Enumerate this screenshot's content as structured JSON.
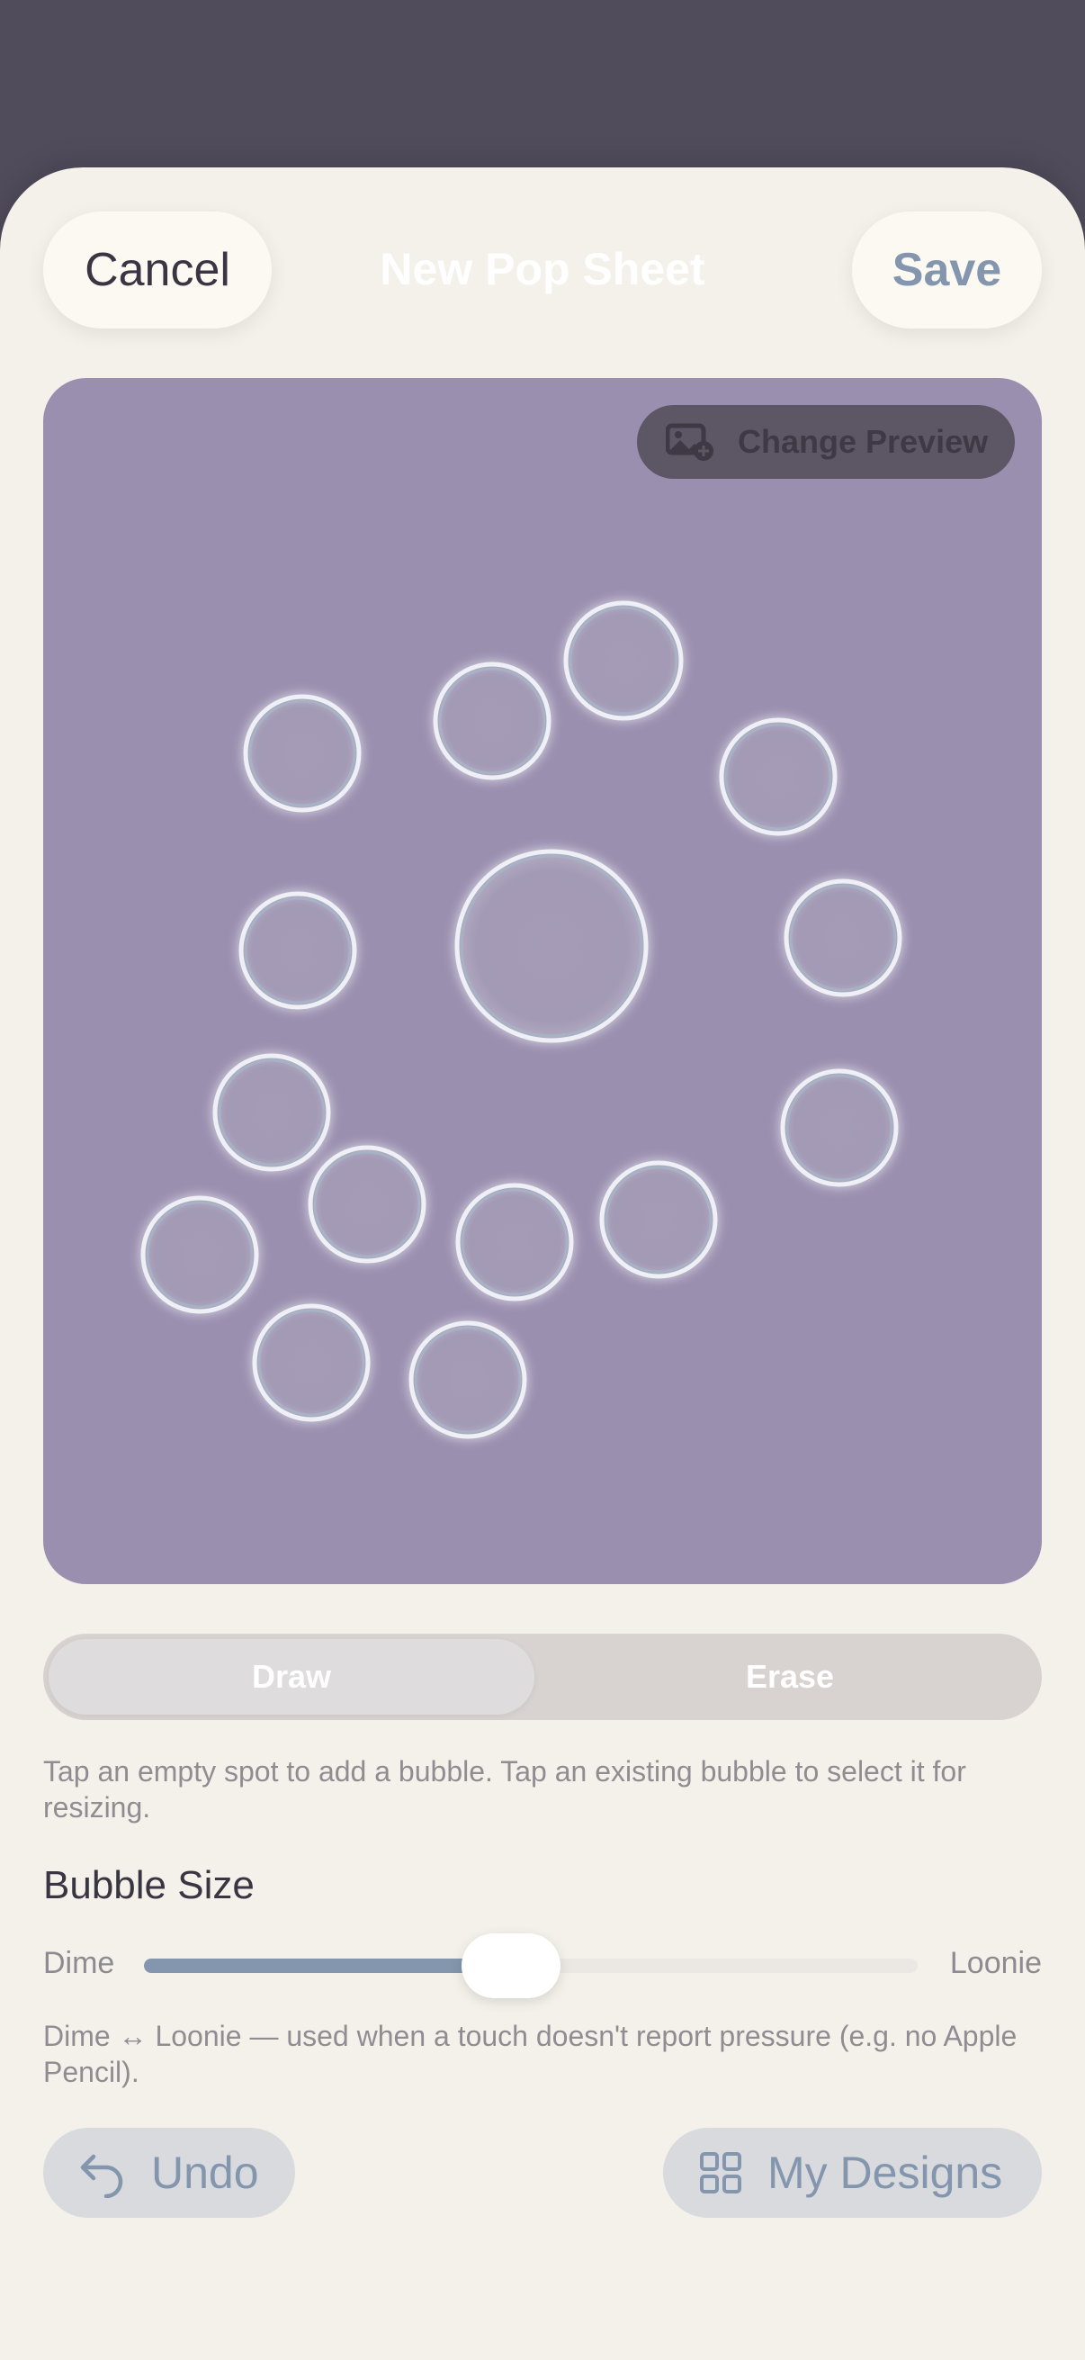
{
  "header": {
    "cancel_label": "Cancel",
    "title": "New Pop Sheet",
    "save_label": "Save"
  },
  "preview": {
    "change_preview_label": "Change Preview",
    "change_preview_icon": "photo-add-icon",
    "background_color": "#9a8faf"
  },
  "mode": {
    "options": [
      "Draw",
      "Erase"
    ],
    "selected": "Draw"
  },
  "help_text": "Tap an empty spot to add a bubble. Tap an existing bubble to select it for resizing.",
  "bubble_size": {
    "title": "Bubble Size",
    "min_label": "Dime",
    "max_label": "Loonie",
    "value_fraction": 0.41,
    "note": "Dime ↔ Loonie — used when a touch doesn't report pressure (e.g. no Apple Pencil)."
  },
  "actions": {
    "undo_label": "Undo",
    "undo_icon": "undo-arrow-icon",
    "designs_label": "My Designs",
    "designs_icon": "grid-icon"
  },
  "colors": {
    "accent": "#8496ad",
    "sheet_background": "#f4f1ea",
    "backdrop": "#514c5c"
  }
}
